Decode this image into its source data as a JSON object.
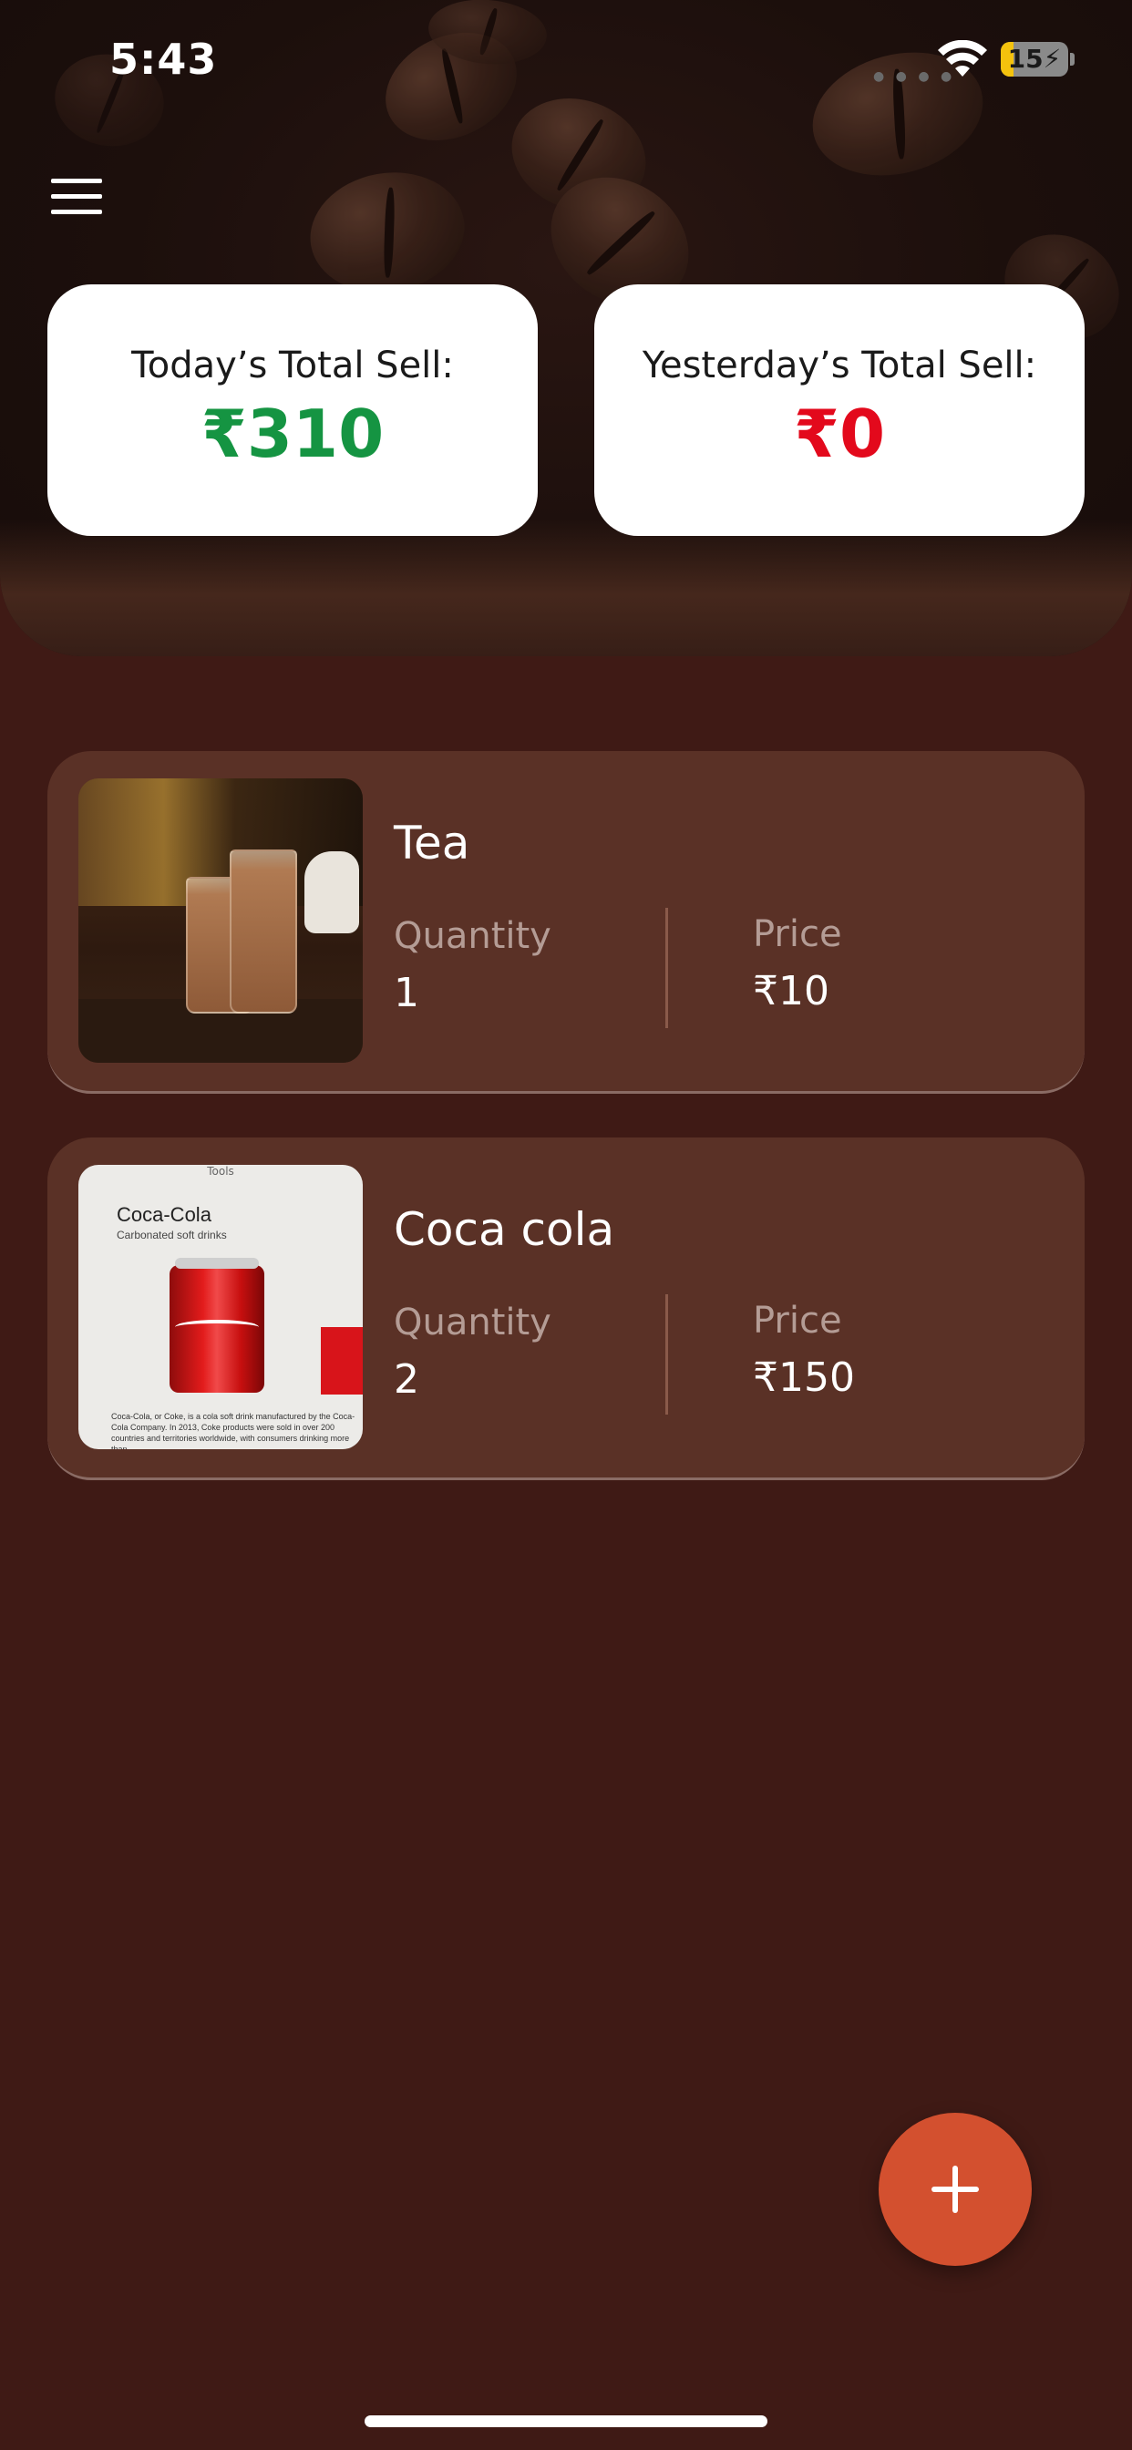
{
  "status_bar": {
    "time": "5:43",
    "battery_level": "15"
  },
  "header": {
    "menu_icon": "hamburger-menu-icon",
    "today": {
      "label": "Today’s Total Sell:",
      "value": "₹310",
      "color": "#159442"
    },
    "yesterday": {
      "label": "Yesterday’s Total Sell:",
      "value": "₹0",
      "color": "#e3091c"
    }
  },
  "items": [
    {
      "name": "Tea",
      "quantity_label": "Quantity",
      "quantity": "1",
      "price_label": "Price",
      "price": "₹10"
    },
    {
      "name": "Coca cola",
      "quantity_label": "Quantity",
      "quantity": "2",
      "price_label": "Price",
      "price": "₹150",
      "thumbnail_text": {
        "tools": "Tools",
        "title": "Coca-Cola",
        "subtitle": "Carbonated soft drinks",
        "body": "Coca-Cola, or Coke, is a cola soft drink manufactured by the Coca-Cola Company. In 2013, Coke products were sold in over 200 countries and territories worldwide, with consumers drinking more than"
      }
    }
  ],
  "fab": {
    "icon": "plus-icon"
  },
  "colors": {
    "background": "#3f1a15",
    "card": "#5a3126",
    "fab": "#d3502f"
  }
}
